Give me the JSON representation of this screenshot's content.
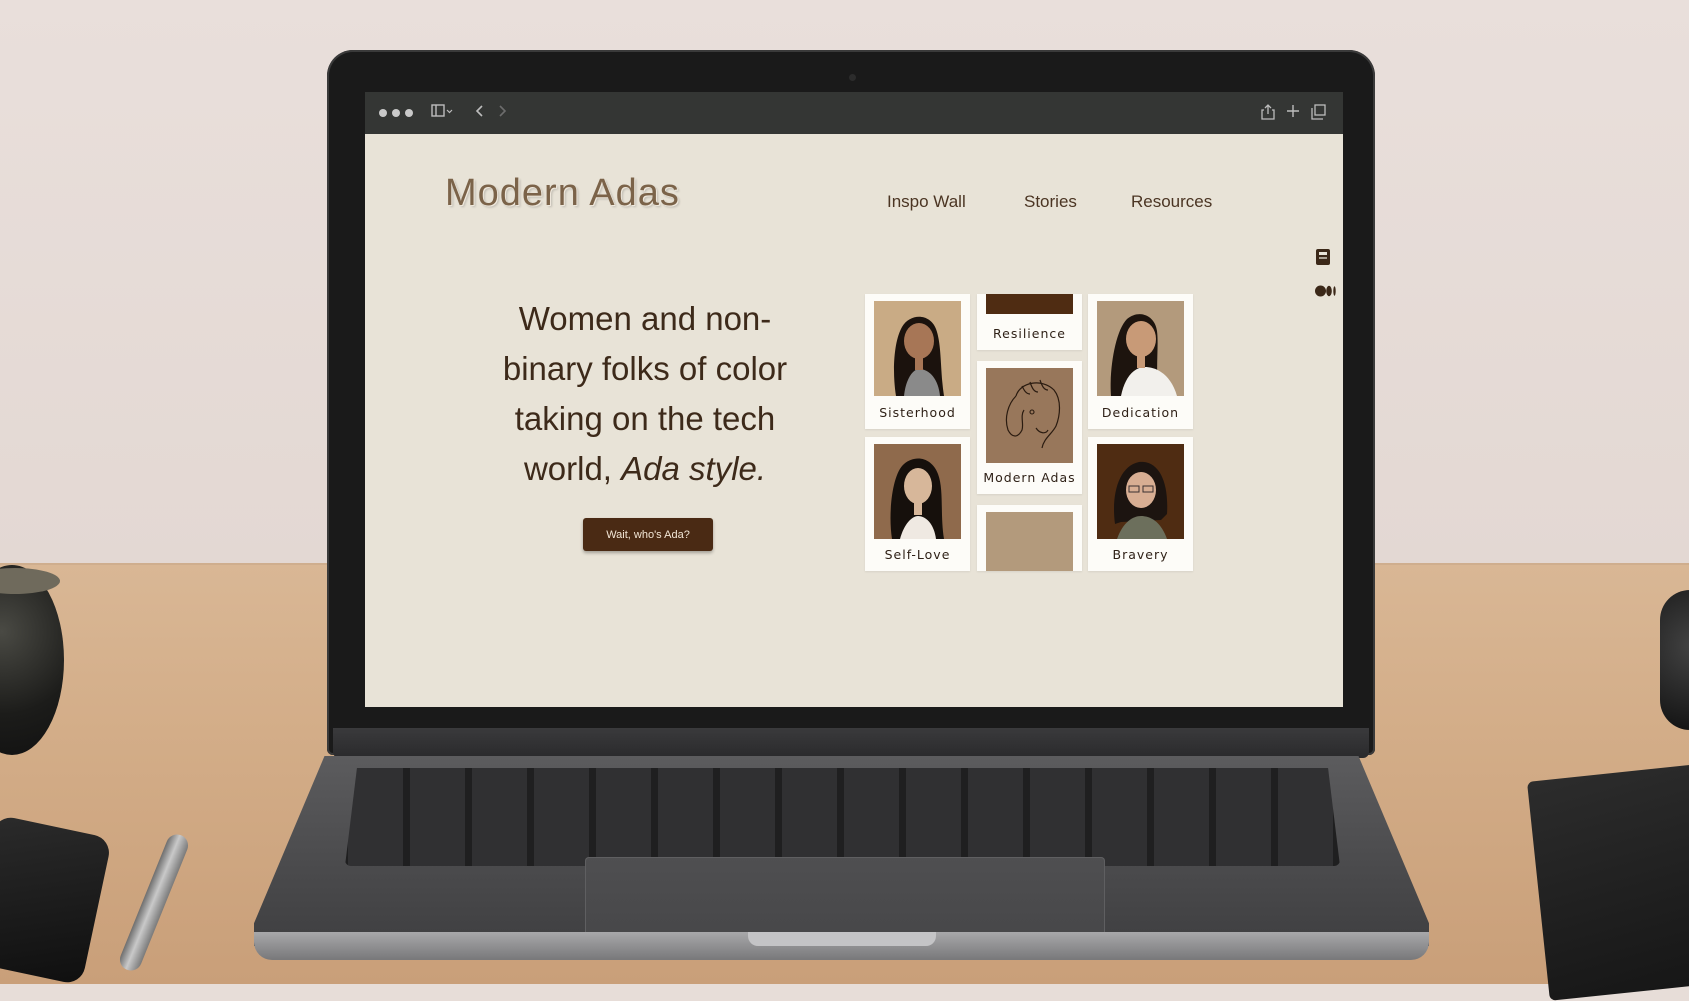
{
  "browser": {
    "toolbar_icons": [
      "more-dots-icon",
      "sidebar-icon",
      "back-icon",
      "forward-icon",
      "share-icon",
      "new-tab-icon",
      "tabs-icon"
    ]
  },
  "site": {
    "logo": "Modern Adas",
    "nav": [
      "Inspo Wall",
      "Stories",
      "Resources"
    ],
    "side_icons": [
      "book-icon",
      "medium-icon"
    ]
  },
  "hero": {
    "line_1": "Women and non-",
    "line_2": "binary folks of color",
    "line_3": "taking on the tech",
    "line_4_prefix": "world, ",
    "line_4_emphasis": "Ada style.",
    "cta": "Wait, who's Ada?"
  },
  "grid": {
    "cards": [
      {
        "label": "Sisterhood"
      },
      {
        "label": "Resilience"
      },
      {
        "label": "Dedication"
      },
      {
        "label": "Modern Adas"
      },
      {
        "label": "Self-Love"
      },
      {
        "label": "Bravery"
      }
    ]
  },
  "colors": {
    "page_bg": "#e8e3d7",
    "brand_brown": "#4a2a14",
    "logo_text": "#7b6349",
    "photo_tan": "#b39a7c",
    "photo_dark": "#4f2c12"
  }
}
